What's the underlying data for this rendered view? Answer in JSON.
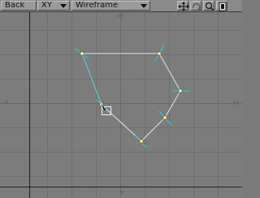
{
  "toolbar": {
    "view_label": "Back",
    "axis_label": "XY",
    "mode_label": "Wireframe",
    "icons": [
      "move-icon",
      "rotate-icon",
      "zoom-icon",
      "maximize-icon"
    ]
  },
  "viewport": {
    "axis_top": "+Y",
    "axis_bottom": "-Y",
    "axis_left": "-X",
    "axis_right": "+X",
    "colors": {
      "background": "#7c7c7c",
      "grid": "#6f6f6f",
      "axis": "#222222",
      "edge": "#e8e8e8",
      "selected_edge": "#5fd6e6",
      "vertex": "#ffffaa",
      "normal": "#2ad2d8"
    }
  }
}
